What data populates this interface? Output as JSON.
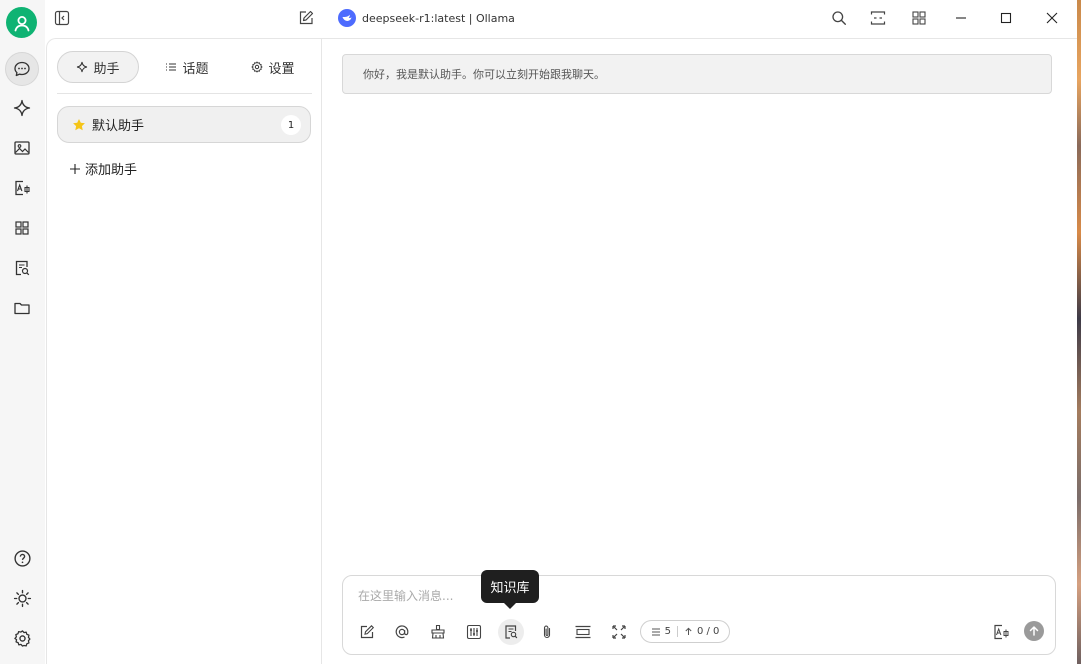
{
  "window": {
    "title": "deepseek-r1:latest | Ollama",
    "icons": [
      "search-icon",
      "subtitle-icon",
      "grid-icon",
      "minimize-icon",
      "maximize-icon",
      "close-icon"
    ]
  },
  "rail": {
    "top_items": [
      "chat-icon",
      "sparkle-icon",
      "image-icon",
      "image-translate-icon",
      "apps-icon",
      "knowledge-icon",
      "folder-icon"
    ],
    "bottom_items": [
      "help-icon",
      "theme-icon",
      "settings-icon"
    ]
  },
  "sidebar": {
    "tabs": [
      {
        "label": "助手",
        "icon": "sparkle-icon"
      },
      {
        "label": "话题",
        "icon": "list-icon"
      },
      {
        "label": "设置",
        "icon": "gear-icon"
      }
    ],
    "assistants": [
      {
        "name": "默认助手",
        "icon": "star-icon",
        "count": "1"
      }
    ],
    "add_assistant_label": "添加助手"
  },
  "chat": {
    "greeting": "你好，我是默认助手。你可以立刻开始跟我聊天。"
  },
  "composer": {
    "placeholder": "在这里输入消息...",
    "tooltip": "知识库",
    "context_count": "5",
    "token_count": "0 / 0",
    "tools": [
      "new-topic-icon",
      "mention-icon",
      "clear-icon",
      "settings-sliders-icon",
      "knowledge-icon",
      "attachment-icon",
      "collapse-icon",
      "fullscreen-icon"
    ]
  },
  "colors": {
    "avatar": "#0fb373",
    "model_logo": "#4d6bfe",
    "star": "#f5c518"
  }
}
